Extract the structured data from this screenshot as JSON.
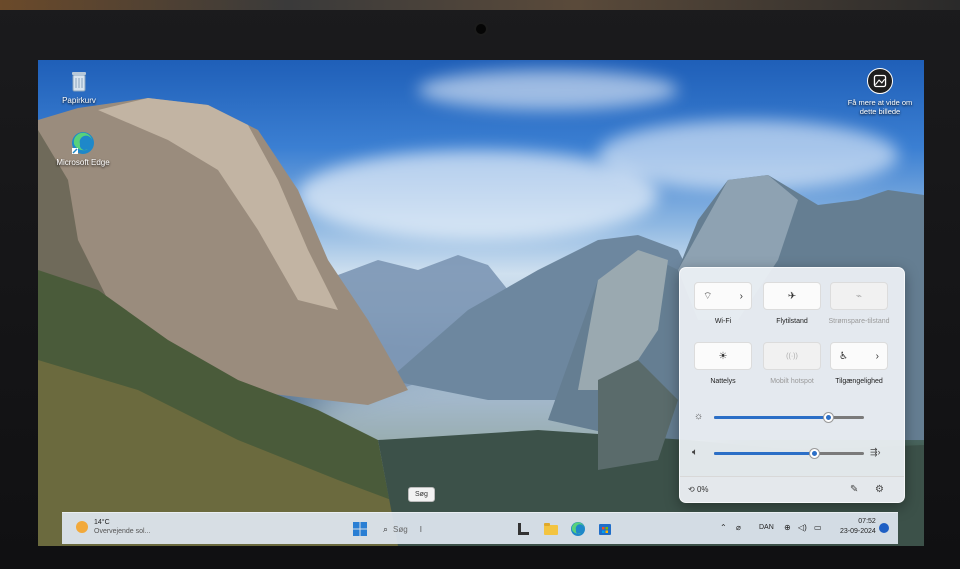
{
  "desktop": {
    "icons": [
      {
        "label": "Papirkurv",
        "icon": "recycle-bin-icon"
      },
      {
        "label": "Microsoft Edge",
        "icon": "edge-icon"
      }
    ],
    "learn_more": "Få mere at vide om dette billede"
  },
  "quick_settings": {
    "tiles": [
      {
        "label": "Wi-Fi",
        "glyph": "⌔",
        "chevron": "›",
        "enabled": true
      },
      {
        "label": "Flytilstand",
        "glyph": "✈",
        "enabled": true
      },
      {
        "label": "Strømspare-tilstand",
        "glyph": "⌁",
        "enabled": false
      },
      {
        "label": "Nattelys",
        "glyph": "☀",
        "enabled": true
      },
      {
        "label": "Mobilt hotspot",
        "glyph": "((·))",
        "enabled": false
      },
      {
        "label": "Tilgængelighed",
        "glyph": "♿",
        "chevron": "›",
        "enabled": true
      }
    ],
    "brightness": 0.76,
    "volume": 0.67,
    "battery": "0%"
  },
  "tooltip": "Søg",
  "taskbar": {
    "weather_temp": "14°C",
    "weather_desc": "Overvejende sol...",
    "search_placeholder": "Søg",
    "language": "DAN",
    "time": "07:52",
    "date": "23-09-2024"
  },
  "colors": {
    "accent": "#2b6fc7",
    "taskbar": "#e1e8f2"
  }
}
